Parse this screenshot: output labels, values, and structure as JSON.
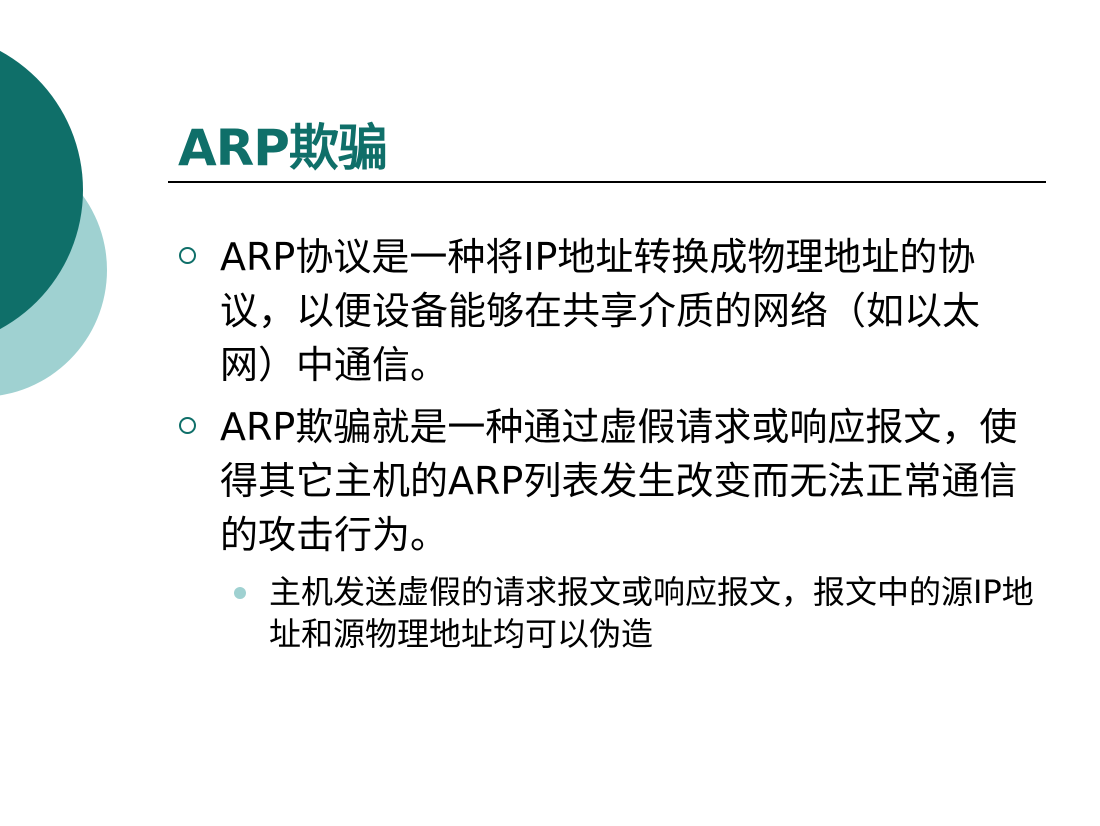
{
  "slide": {
    "title": "ARP欺骗",
    "bullets": [
      {
        "text": "ARP协议是一种将IP地址转换成物理地址的协议，以便设备能够在共享介质的网络（如以太网）中通信。"
      },
      {
        "text": "ARP欺骗就是一种通过虚假请求或响应报文，使得其它主机的ARP列表发生改变而无法正常通信的攻击行为。",
        "sub": [
          {
            "text": "主机发送虚假的请求报文或响应报文，报文中的源IP地址和源物理地址均可以伪造"
          }
        ]
      }
    ]
  },
  "colors": {
    "accent_dark": "#0f6f69",
    "accent_light": "#9fd1d1",
    "text": "#000000",
    "background": "#ffffff"
  }
}
